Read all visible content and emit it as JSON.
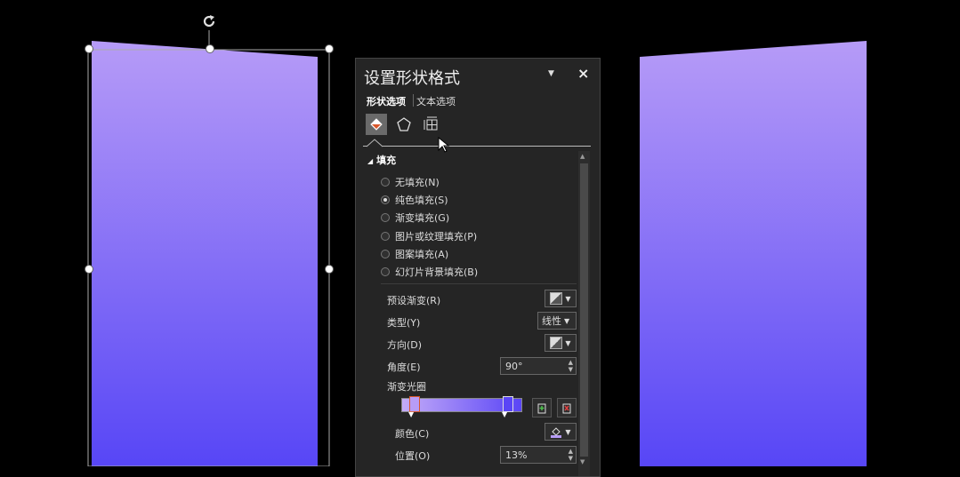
{
  "panel": {
    "title": "设置形状格式",
    "tabs": [
      "形状选项",
      "文本选项"
    ],
    "icons": [
      "fill-line-icon",
      "effects-pentagon-icon",
      "size-properties-icon"
    ],
    "section": "填充",
    "fill_options": [
      {
        "label": "无填充(N)",
        "selected": false
      },
      {
        "label": "纯色填充(S)",
        "selected": true
      },
      {
        "label": "渐变填充(G)",
        "selected": false
      },
      {
        "label": "图片或纹理填充(P)",
        "selected": false
      },
      {
        "label": "图案填充(A)",
        "selected": false
      },
      {
        "label": "幻灯片背景填充(B)",
        "selected": false
      }
    ],
    "preset_gradient_label": "预设渐变(R)",
    "type_label": "类型(Y)",
    "type_value": "线性",
    "direction_label": "方向(D)",
    "angle_label": "角度(E)",
    "angle_value": "90°",
    "gradient_stops_label": "渐变光圈",
    "color_label": "颜色(C)",
    "position_label": "位置(O)",
    "position_value": "13%"
  },
  "colors": {
    "gradient_top": "#b79cf6",
    "gradient_bottom": "#5a45f6",
    "accent": "#d9572b"
  }
}
